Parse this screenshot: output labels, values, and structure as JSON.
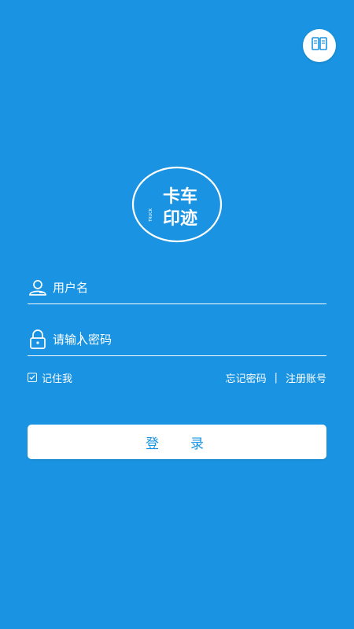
{
  "colors": {
    "background": "#1a94e2",
    "accent": "#1a94e2",
    "foreground": "#ffffff"
  },
  "header": {
    "corner_icon": "book-icon"
  },
  "logo": {
    "line1": "卡车",
    "line2": "印迹",
    "small_text": "TRUCK",
    "icon": "logo-icon"
  },
  "form": {
    "username": {
      "placeholder": "用户名",
      "value": "",
      "icon": "user-icon"
    },
    "password": {
      "placeholder": "请输入密码",
      "value": "",
      "icon": "lock-icon"
    }
  },
  "options": {
    "remember_label": "记住我",
    "remember_checked": true,
    "forgot_label": "忘记密码",
    "separator": "|",
    "register_label": "注册账号"
  },
  "login_button": {
    "label": "登录"
  }
}
